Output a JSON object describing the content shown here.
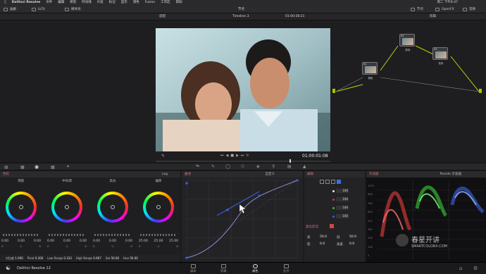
{
  "menubar": {
    "app": "DaVinci Resolve",
    "items": [
      "文件",
      "编辑",
      "修剪",
      "时间线",
      "片段",
      "标记",
      "显示",
      "调色",
      "Fusion",
      "工作区",
      "帮助"
    ],
    "clock": "周二 下午6:47"
  },
  "toolbar": {
    "left_items": [
      "画廊",
      "LUTs",
      "媒体池"
    ],
    "title": "节点",
    "right_items": [
      "节点",
      "OpenFX",
      "音频"
    ]
  },
  "viewbar": {
    "zoom": "适配",
    "timeline": "Timeline 3",
    "timecode": "01:00:58:21",
    "node_mode": "剪辑"
  },
  "transport": {
    "timecode": "01:00:01:08"
  },
  "nodes": [
    {
      "num": "01",
      "caption": "调色"
    },
    {
      "num": "02",
      "caption": "肤色"
    },
    {
      "num": "03",
      "caption": "色彩"
    }
  ],
  "color_wheels": {
    "title": "色轮",
    "mode": "Log",
    "wheels": [
      {
        "label": "阴影",
        "values": [
          "0.00",
          "0.00",
          "0.00"
        ],
        "letters": [
          "R",
          "G",
          "B"
        ]
      },
      {
        "label": "中间调",
        "values": [
          "0.00",
          "0.00",
          "0.00"
        ],
        "letters": [
          "R",
          "G",
          "B"
        ]
      },
      {
        "label": "高光",
        "values": [
          "0.00",
          "0.00",
          "0.00"
        ],
        "letters": [
          "R",
          "G",
          "B"
        ]
      },
      {
        "label": "偏移",
        "values": [
          "25.00",
          "25.00",
          "25.00"
        ],
        "letters": [
          "R",
          "G",
          "B"
        ]
      }
    ],
    "adjustments": [
      {
        "label": "对比度",
        "value": "1.000"
      },
      {
        "label": "Pivot",
        "value": "0.300"
      },
      {
        "label": "Low Range",
        "value": "0.333"
      },
      {
        "label": "High Range",
        "value": "0.667"
      },
      {
        "label": "Sat",
        "value": "50.00"
      },
      {
        "label": "Hue",
        "value": "50.00"
      }
    ]
  },
  "curves": {
    "title": "曲线",
    "mode": "自定义"
  },
  "mixer": {
    "title": "编辑",
    "rows": [
      {
        "color": "#e8e8e8",
        "value": "100"
      },
      {
        "color": "#e03030",
        "value": "100"
      },
      {
        "color": "#30c030",
        "value": "100"
      },
      {
        "color": "#3060e0",
        "value": "100"
      }
    ],
    "soft_clip_label": "柔化剪切",
    "params": [
      {
        "label": "高",
        "value": "50.0"
      },
      {
        "label": "低",
        "value": "50.0"
      },
      {
        "label": "软",
        "value": "0.0"
      },
      {
        "label": "高柔",
        "value": "0.0"
      }
    ]
  },
  "scopes": {
    "title": "示波器",
    "mode": "Parade 示波器",
    "labels": [
      "1023",
      "896",
      "768",
      "640",
      "512",
      "384",
      "256",
      "128",
      "0"
    ],
    "watermark_main": "春星开讲",
    "watermark_sub": "SMARTCOLORX.COM"
  },
  "bottombar": {
    "app_name": "DaVinci Resolve 12",
    "tabs": [
      "媒体",
      "剪辑",
      "调色",
      "交付"
    ],
    "active": "调色"
  },
  "colors": {
    "accent": "#d04545",
    "active_tab": "#e0e0e0",
    "node_line": "#b8d400"
  }
}
